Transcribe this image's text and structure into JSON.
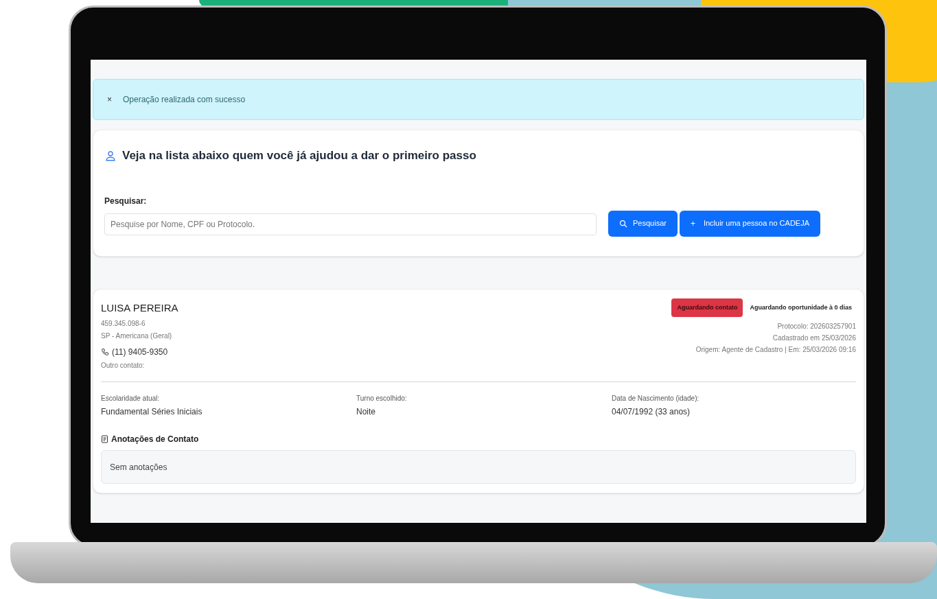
{
  "alert": {
    "close": "×",
    "message": "Operação realizada com sucesso"
  },
  "search_card": {
    "title": "Veja na lista abaixo quem você já ajudou a dar o primeiro passo",
    "label": "Pesquisar:",
    "placeholder": "Pesquise por Nome, CPF ou Protocolo.",
    "buttons": [
      {
        "kind": "search",
        "label": "Pesquisar"
      },
      {
        "kind": "add",
        "icon": "+",
        "label": "Incluir uma pessoa no CADEJA"
      }
    ]
  },
  "person": {
    "name": "LUISA PEREIRA",
    "document": "459.345.098-6",
    "location": "SP - Americana (Geral)",
    "phone": "(11) 9405-9350",
    "other_contact": "Outro contato:",
    "status_badge": "Aguardando contato",
    "status_note": "Aguardando oportunidade à 0 dias",
    "details": [
      "Protocolo: 202603257901",
      "Cadastrado em 25/03/2026",
      "Origem: Agente de Cadastro | Em: 25/03/2026 09:16"
    ],
    "fields": [
      {
        "label": "Escolaridade atual:",
        "value": "Fundamental Séries Iniciais"
      },
      {
        "label": "Turno escolhido:",
        "value": "Noite"
      },
      {
        "label": "Data de Nascimento (idade):",
        "value": "04/07/1992 (33 anos)"
      }
    ],
    "notes_title": "Anotações de Contato",
    "notes": "Sem anotações"
  }
}
